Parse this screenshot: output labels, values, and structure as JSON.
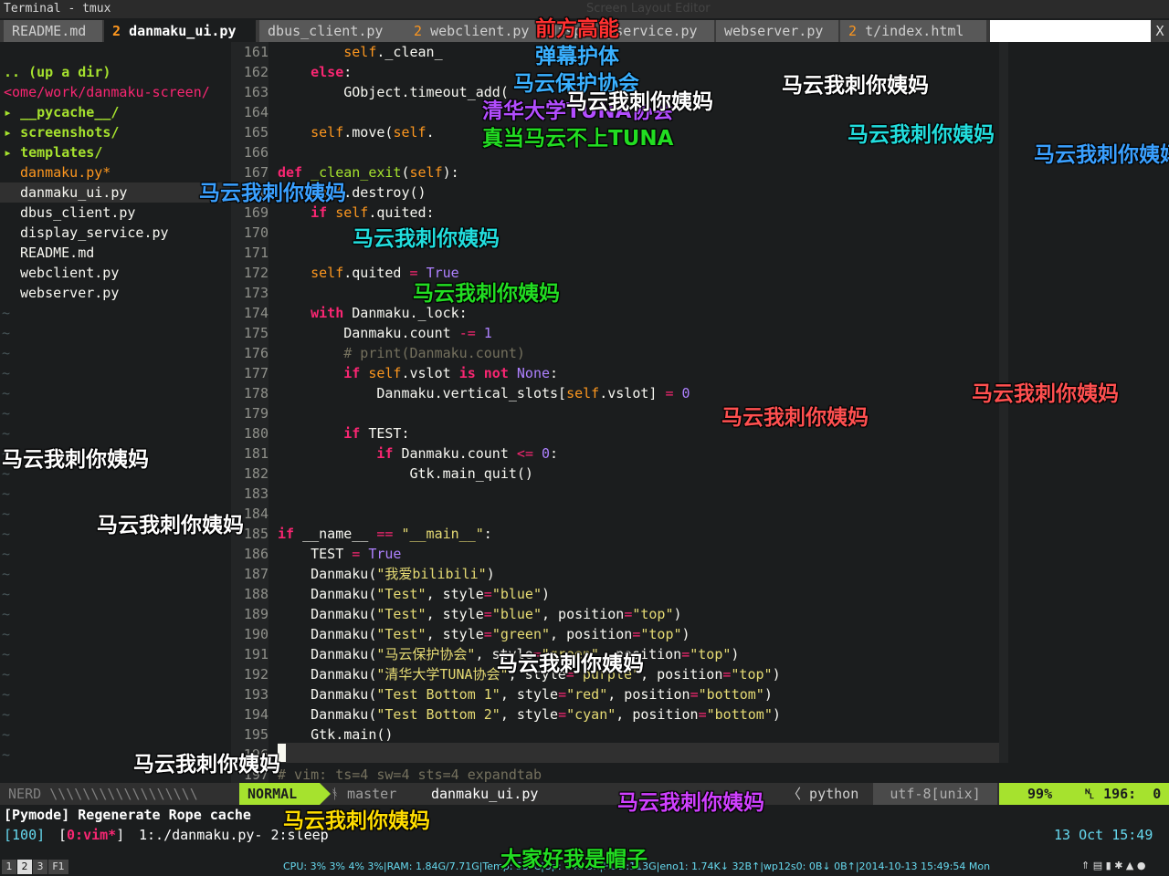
{
  "window": {
    "title": "Terminal - tmux"
  },
  "tabline": {
    "tabs": [
      {
        "num": "",
        "label": "README.md",
        "selected": false
      },
      {
        "num": "2",
        "label": "danmaku_ui.py",
        "selected": true
      },
      {
        "num": "",
        "label": "dbus_client.py",
        "selected": false
      },
      {
        "num": "2",
        "label": "webclient.py",
        "selected": false
      },
      {
        "num": "",
        "label": "display_service.py",
        "selected": false
      },
      {
        "num": "",
        "label": "webserver.py",
        "selected": false
      },
      {
        "num": "2",
        "label": "t/index.html",
        "selected": false
      }
    ],
    "close": "X",
    "background_title": "Screen Layout Editor"
  },
  "nerdtree": {
    "up_dir": ".. (up a dir)",
    "root": "<ome/work/danmaku-screen/",
    "dirs": [
      "__pycache__/",
      "screenshots/",
      "templates/"
    ],
    "dir_arrow": "▸",
    "files": [
      {
        "name": "danmaku.py*",
        "modified": true
      },
      {
        "name": "danmaku_ui.py",
        "modified": false
      },
      {
        "name": "dbus_client.py",
        "modified": false
      },
      {
        "name": "display_service.py",
        "modified": false
      },
      {
        "name": "README.md",
        "modified": false
      },
      {
        "name": "webclient.py",
        "modified": false
      },
      {
        "name": "webserver.py",
        "modified": false
      }
    ],
    "tilde": "~"
  },
  "editor": {
    "lines": [
      {
        "n": "161",
        "code": "        self._clean_"
      },
      {
        "n": "162",
        "code": "    else:"
      },
      {
        "n": "163",
        "code": "        GObject.timeout_add("
      },
      {
        "n": "164",
        "code": ""
      },
      {
        "n": "165",
        "code": "    self.move(self."
      },
      {
        "n": "166",
        "code": ""
      },
      {
        "n": "167",
        "code": "def _clean_exit(self):"
      },
      {
        "n": "168",
        "code": "    self.destroy()"
      },
      {
        "n": "169",
        "code": "    if self.quited:"
      },
      {
        "n": "170",
        "code": ""
      },
      {
        "n": "171",
        "code": ""
      },
      {
        "n": "172",
        "code": "    self.quited = True"
      },
      {
        "n": "173",
        "code": ""
      },
      {
        "n": "174",
        "code": "    with Danmaku._lock:"
      },
      {
        "n": "175",
        "code": "        Danmaku.count -= 1"
      },
      {
        "n": "176",
        "code": "        # print(Danmaku.count)"
      },
      {
        "n": "177",
        "code": "        if self.vslot is not None:"
      },
      {
        "n": "178",
        "code": "            Danmaku.vertical_slots[self.vslot] = 0"
      },
      {
        "n": "179",
        "code": ""
      },
      {
        "n": "180",
        "code": "        if TEST:"
      },
      {
        "n": "181",
        "code": "            if Danmaku.count <= 0:"
      },
      {
        "n": "182",
        "code": "                Gtk.main_quit()"
      },
      {
        "n": "183",
        "code": ""
      },
      {
        "n": "184",
        "code": ""
      },
      {
        "n": "185",
        "code": "if __name__ == \"__main__\":"
      },
      {
        "n": "186",
        "code": "    TEST = True"
      },
      {
        "n": "187",
        "code": "    Danmaku(\"我爱bilibili\")"
      },
      {
        "n": "188",
        "code": "    Danmaku(\"Test\", style=\"blue\")"
      },
      {
        "n": "189",
        "code": "    Danmaku(\"Test\", style=\"blue\", position=\"top\")"
      },
      {
        "n": "190",
        "code": "    Danmaku(\"Test\", style=\"green\", position=\"top\")"
      },
      {
        "n": "191",
        "code": "    Danmaku(\"马云保护协会\", style=\"green\", position=\"top\")"
      },
      {
        "n": "192",
        "code": "    Danmaku(\"清华大学TUNA协会\", style=\"purple\", position=\"top\")"
      },
      {
        "n": "193",
        "code": "    Danmaku(\"Test Bottom 1\", style=\"red\", position=\"bottom\")"
      },
      {
        "n": "194",
        "code": "    Danmaku(\"Test Bottom 2\", style=\"cyan\", position=\"bottom\")"
      },
      {
        "n": "195",
        "code": "    Gtk.main()"
      },
      {
        "n": "196",
        "code": ""
      },
      {
        "n": "197",
        "code": "# vim: ts=4 sw=4 sts=4 expandtab"
      }
    ]
  },
  "statusline": {
    "nerd_label": "NERD",
    "nerd_fill": "\\\\\\\\\\\\\\\\\\\\\\\\\\\\\\\\\\\\",
    "mode": "NORMAL",
    "branch": "master",
    "file": "danmaku_ui.py",
    "filetype": "python",
    "encoding": "utf-8[unix]",
    "percent": "99%",
    "line": "196:",
    "col": "0"
  },
  "cmdline": {
    "text": "[Pymode] Regenerate Rope cache"
  },
  "tmux": {
    "session": "[100]",
    "window_active": "0:vim*",
    "windows": "1:./danmaku.py- 2:sleep",
    "date": "13 Oct 15:49"
  },
  "sysbar": {
    "workspaces": [
      "1",
      "2",
      "3",
      "F1"
    ],
    "active_ws": "2",
    "stats": "CPU: 3% 3% 4% 3%|RAM: 1.84G/7.71G|Temp: 53°C|Up: 14d 5h|HDD:113G|eno1: 1.74K↓ 32B↑|wp12s0: 0B↓ 0B↑|2014-10-13 15:49:54 Mon"
  },
  "danmaku": [
    {
      "text": "前方高能",
      "color": "#ff3030"
    },
    {
      "text": "弹幕护体",
      "color": "#3ab0ff"
    },
    {
      "text": "马云保护协会",
      "color": "#3ab0ff"
    },
    {
      "text": "马云我刺你姨妈",
      "color": "#ffffff"
    },
    {
      "text": "清华大学TUNA协会",
      "color": "#b34dff"
    },
    {
      "text": "马云我刺你姨妈",
      "color": "#ffffff"
    },
    {
      "text": "真当马云不上TUNA",
      "color": "#22dd22"
    },
    {
      "text": "马云我刺你姨妈",
      "color": "#22dddd"
    },
    {
      "text": "马云我刺你姨妈",
      "color": "#3aa0ff"
    },
    {
      "text": "马云我刺你姨妈",
      "color": "#3aa0ff"
    },
    {
      "text": "马云我刺你姨妈",
      "color": "#22dddd"
    },
    {
      "text": "马云我刺你姨妈",
      "color": "#22dd22"
    },
    {
      "text": "马云我刺你姨妈",
      "color": "#ff5050"
    },
    {
      "text": "马云我刺你姨妈",
      "color": "#ff5050"
    },
    {
      "text": "马云我刺你姨妈",
      "color": "#ffffff"
    },
    {
      "text": "马云我刺你姨妈",
      "color": "#ffffff"
    },
    {
      "text": "马云我刺你姨妈",
      "color": "#ffffff"
    },
    {
      "text": "马云我刺你姨妈",
      "color": "#ffffff"
    },
    {
      "text": "马云我刺你姨妈",
      "color": "#ffdd00"
    },
    {
      "text": "马云我刺你姨妈",
      "color": "#d040ff"
    },
    {
      "text": "大家好我是帽子",
      "color": "#22dd22"
    }
  ]
}
